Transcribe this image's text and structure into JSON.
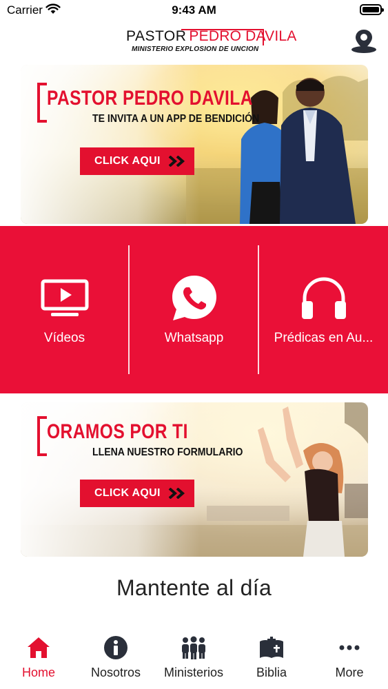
{
  "status_bar": {
    "carrier": "Carrier",
    "time": "9:43 AM"
  },
  "header": {
    "logo_line1_word": "PASTOR",
    "logo_line1_name": "PEDRO DAVILA",
    "logo_line2": "MINISTERIO EXPLOSION DE UNCION",
    "location_icon": "map-pin-icon"
  },
  "banner_invite": {
    "title": "PASTOR PEDRO DAVILA",
    "subtitle": "TE INVITA A UN APP DE BENDICIÓN",
    "button_label": "CLICK AQUI"
  },
  "features": [
    {
      "label": "Vídeos",
      "icon": "tv-play-icon"
    },
    {
      "label": "Whatsapp",
      "icon": "whatsapp-icon"
    },
    {
      "label": "Prédicas en Au...",
      "icon": "headphones-icon"
    }
  ],
  "banner_prayer": {
    "title": "ORAMOS POR TI",
    "subtitle": "LLENA NUESTRO FORMULARIO",
    "button_label": "CLICK AQUI"
  },
  "section": {
    "heading": "Mantente al día"
  },
  "tab_bar": {
    "active_index": 0,
    "tabs": [
      {
        "label": "Home",
        "icon": "home-icon"
      },
      {
        "label": "Nosotros",
        "icon": "info-icon"
      },
      {
        "label": "Ministerios",
        "icon": "people-group-icon"
      },
      {
        "label": "Biblia",
        "icon": "bible-icon"
      },
      {
        "label": "More",
        "icon": "more-dots-icon"
      }
    ]
  },
  "colors": {
    "brand_red": "#e3102f",
    "feature_band_red": "#ea1037",
    "text_dark": "#222222",
    "white": "#ffffff"
  }
}
